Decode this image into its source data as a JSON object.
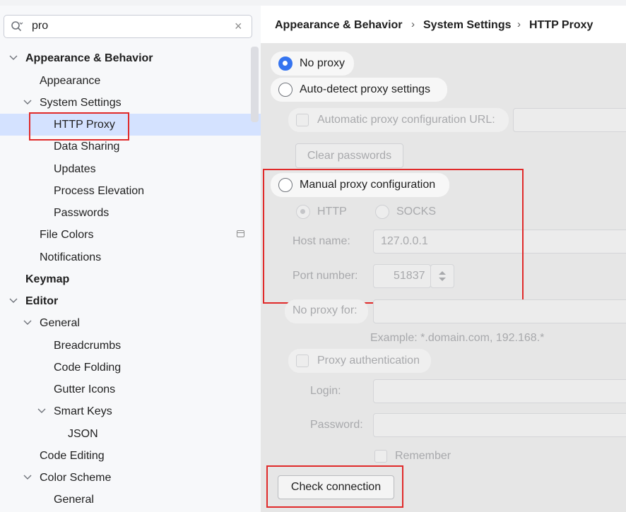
{
  "search": {
    "value": "pro"
  },
  "tree": {
    "items": [
      {
        "label": "Appearance & Behavior"
      },
      {
        "label": "Appearance"
      },
      {
        "label": "System Settings"
      },
      {
        "label": "HTTP Proxy"
      },
      {
        "label": "Data Sharing"
      },
      {
        "label": "Updates"
      },
      {
        "label": "Process Elevation"
      },
      {
        "label": "Passwords"
      },
      {
        "label": "File Colors"
      },
      {
        "label": "Notifications"
      },
      {
        "label": "Keymap"
      },
      {
        "label": "Editor"
      },
      {
        "label": "General"
      },
      {
        "label": "Breadcrumbs"
      },
      {
        "label": "Code Folding"
      },
      {
        "label": "Gutter Icons"
      },
      {
        "label": "Smart Keys"
      },
      {
        "label": "JSON"
      },
      {
        "label": "Code Editing"
      },
      {
        "label": "Color Scheme"
      },
      {
        "label": "General"
      }
    ]
  },
  "breadcrumb": {
    "items": [
      "Appearance & Behavior",
      "System Settings",
      "HTTP Proxy"
    ],
    "separator": "›"
  },
  "proxy": {
    "no_proxy": "No proxy",
    "auto_detect": "Auto-detect proxy settings",
    "auto_config_url": "Automatic proxy configuration URL:",
    "clear_passwords": "Clear passwords",
    "manual": "Manual proxy configuration",
    "http": "HTTP",
    "socks": "SOCKS",
    "host_label": "Host name:",
    "host_value": "127.0.0.1",
    "port_label": "Port number:",
    "port_value": "51837",
    "no_proxy_for": "No proxy for:",
    "example": "Example: *.domain.com, 192.168.*",
    "proxy_auth": "Proxy authentication",
    "login": "Login:",
    "password": "Password:",
    "remember": "Remember",
    "check_connection": "Check connection"
  },
  "colors": {
    "accent": "#3574f0",
    "selection": "#d4e2ff",
    "highlight_box": "#e02a2a"
  }
}
